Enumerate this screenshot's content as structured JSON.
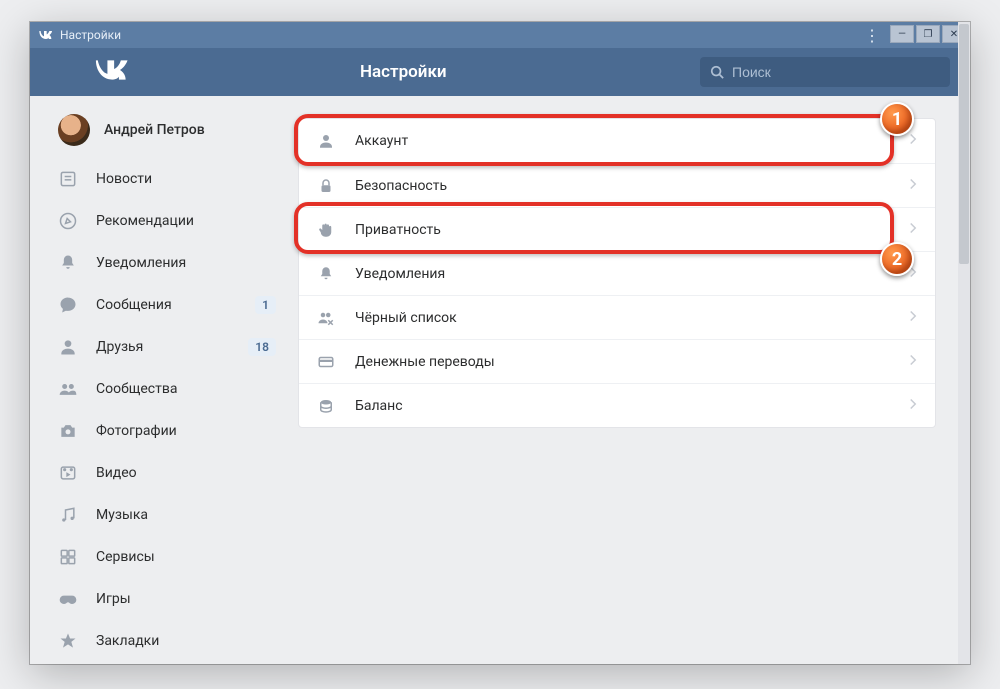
{
  "window": {
    "title": "Настройки"
  },
  "header": {
    "title": "Настройки"
  },
  "search": {
    "placeholder": "Поиск"
  },
  "profile": {
    "name": "Андрей Петров"
  },
  "sidebar": {
    "items": [
      {
        "label": "Новости",
        "icon": "news",
        "badge": ""
      },
      {
        "label": "Рекомендации",
        "icon": "compass",
        "badge": ""
      },
      {
        "label": "Уведомления",
        "icon": "bell",
        "badge": ""
      },
      {
        "label": "Сообщения",
        "icon": "chat",
        "badge": "1"
      },
      {
        "label": "Друзья",
        "icon": "user",
        "badge": "18"
      },
      {
        "label": "Сообщества",
        "icon": "group",
        "badge": ""
      },
      {
        "label": "Фотографии",
        "icon": "camera",
        "badge": ""
      },
      {
        "label": "Видео",
        "icon": "video",
        "badge": ""
      },
      {
        "label": "Музыка",
        "icon": "music",
        "badge": ""
      },
      {
        "label": "Сервисы",
        "icon": "apps",
        "badge": ""
      },
      {
        "label": "Игры",
        "icon": "game",
        "badge": ""
      },
      {
        "label": "Закладки",
        "icon": "star",
        "badge": ""
      }
    ]
  },
  "settings": {
    "items": [
      {
        "label": "Аккаунт",
        "icon": "account"
      },
      {
        "label": "Безопасность",
        "icon": "lock"
      },
      {
        "label": "Приватность",
        "icon": "hand"
      },
      {
        "label": "Уведомления",
        "icon": "bell"
      },
      {
        "label": "Чёрный список",
        "icon": "blocklist"
      },
      {
        "label": "Денежные переводы",
        "icon": "card"
      },
      {
        "label": "Баланс",
        "icon": "coins"
      }
    ]
  },
  "callouts": {
    "one": "1",
    "two": "2"
  },
  "colors": {
    "accent": "#4b6b92",
    "highlight": "#e33127",
    "callout": "#e85a1a"
  }
}
